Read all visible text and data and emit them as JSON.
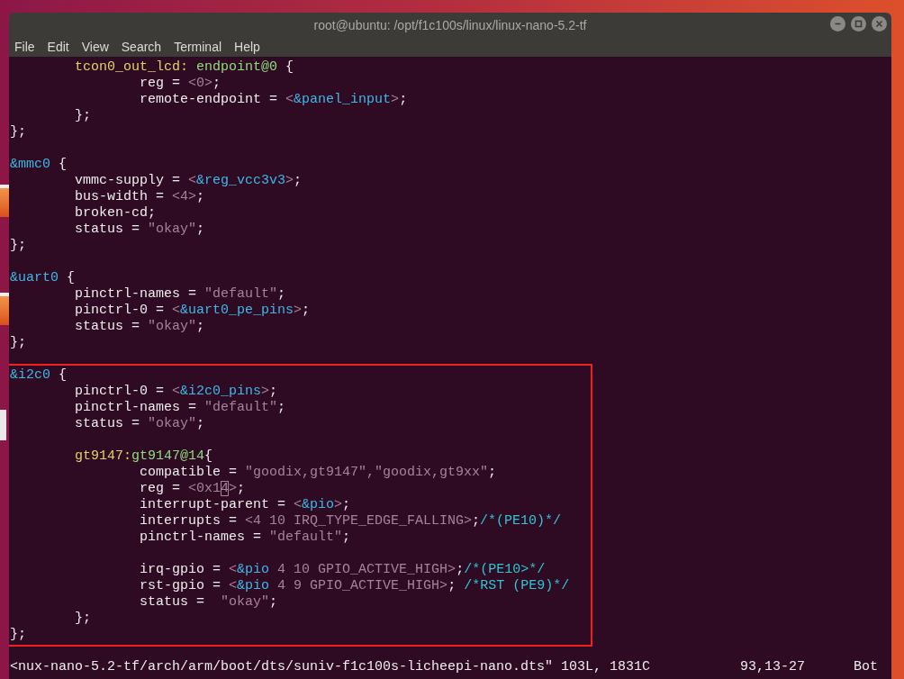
{
  "window": {
    "title": "root@ubuntu: /opt/f1c100s/linux/linux-nano-5.2-tf"
  },
  "menu": [
    "File",
    "Edit",
    "View",
    "Search",
    "Terminal",
    "Help"
  ],
  "lines": [
    {
      "kind": "code",
      "segments": [
        {
          "text": "        tcon0_out_lcd:",
          "kind": "label"
        },
        {
          "text": " endpoint@0",
          "kind": "node"
        },
        {
          "text": " {"
        }
      ]
    },
    {
      "kind": "code",
      "segments": [
        {
          "text": "                reg = "
        },
        {
          "text": "<0>",
          "kind": "value"
        },
        {
          "text": ";"
        }
      ]
    },
    {
      "kind": "code",
      "segments": [
        {
          "text": "                remote-endpoint = "
        },
        {
          "text": "<",
          "kind": "value"
        },
        {
          "text": "&panel_input",
          "kind": "ref"
        },
        {
          "text": ">",
          "kind": "value"
        },
        {
          "text": ";"
        }
      ]
    },
    {
      "kind": "code",
      "segments": [
        {
          "text": "        };"
        }
      ]
    },
    {
      "kind": "code",
      "segments": [
        {
          "text": "};"
        }
      ]
    },
    {
      "kind": "blank"
    },
    {
      "kind": "code",
      "segments": [
        {
          "text": "&mmc0",
          "kind": "ref"
        },
        {
          "text": " {"
        }
      ]
    },
    {
      "kind": "code",
      "segments": [
        {
          "text": "        vmmc-supply = "
        },
        {
          "text": "<",
          "kind": "value"
        },
        {
          "text": "&reg_vcc3v3",
          "kind": "ref"
        },
        {
          "text": ">",
          "kind": "value"
        },
        {
          "text": ";"
        }
      ]
    },
    {
      "kind": "code",
      "segments": [
        {
          "text": "        bus-width = "
        },
        {
          "text": "<4>",
          "kind": "value"
        },
        {
          "text": ";"
        }
      ]
    },
    {
      "kind": "code",
      "segments": [
        {
          "text": "        broken-cd;"
        }
      ]
    },
    {
      "kind": "code",
      "segments": [
        {
          "text": "        status = "
        },
        {
          "text": "\"okay\"",
          "kind": "value"
        },
        {
          "text": ";"
        }
      ]
    },
    {
      "kind": "code",
      "segments": [
        {
          "text": "};"
        }
      ]
    },
    {
      "kind": "blank"
    },
    {
      "kind": "code",
      "segments": [
        {
          "text": "&uart0",
          "kind": "ref"
        },
        {
          "text": " {"
        }
      ]
    },
    {
      "kind": "code",
      "segments": [
        {
          "text": "        pinctrl-names = "
        },
        {
          "text": "\"default\"",
          "kind": "value"
        },
        {
          "text": ";"
        }
      ]
    },
    {
      "kind": "code",
      "segments": [
        {
          "text": "        pinctrl-0 = "
        },
        {
          "text": "<",
          "kind": "value"
        },
        {
          "text": "&uart0_pe_pins",
          "kind": "ref"
        },
        {
          "text": ">",
          "kind": "value"
        },
        {
          "text": ";"
        }
      ]
    },
    {
      "kind": "code",
      "segments": [
        {
          "text": "        status = "
        },
        {
          "text": "\"okay\"",
          "kind": "value"
        },
        {
          "text": ";"
        }
      ]
    },
    {
      "kind": "code",
      "segments": [
        {
          "text": "};"
        }
      ]
    },
    {
      "kind": "blank"
    }
  ],
  "highlight_box": {
    "lines": [
      {
        "kind": "code",
        "segments": [
          {
            "text": "&i2c0",
            "kind": "ref"
          },
          {
            "text": " {"
          }
        ]
      },
      {
        "kind": "code",
        "segments": [
          {
            "text": "        pinctrl-0 = "
          },
          {
            "text": "<",
            "kind": "value"
          },
          {
            "text": "&i2c0_pins",
            "kind": "ref"
          },
          {
            "text": ">",
            "kind": "value"
          },
          {
            "text": ";"
          }
        ]
      },
      {
        "kind": "code",
        "segments": [
          {
            "text": "        pinctrl-names = "
          },
          {
            "text": "\"default\"",
            "kind": "value"
          },
          {
            "text": ";"
          }
        ]
      },
      {
        "kind": "code",
        "segments": [
          {
            "text": "        status = "
          },
          {
            "text": "\"okay\"",
            "kind": "value"
          },
          {
            "text": ";"
          }
        ]
      },
      {
        "kind": "blank"
      },
      {
        "kind": "code",
        "segments": [
          {
            "text": "        gt9147",
            "kind": "label"
          },
          {
            "text": ":",
            "kind": "label"
          },
          {
            "text": "gt9147@14",
            "kind": "node"
          },
          {
            "text": "{"
          }
        ]
      },
      {
        "kind": "code",
        "segments": [
          {
            "text": "                compatible = "
          },
          {
            "text": "\"goodix,gt9147\",\"goodix,gt9xx\"",
            "kind": "value"
          },
          {
            "text": ";"
          }
        ]
      },
      {
        "kind": "code",
        "segments": [
          {
            "text": "                reg = "
          },
          {
            "text": "<0x1",
            "kind": "value"
          },
          {
            "text": "4",
            "kind": "value",
            "cursor": true
          },
          {
            "text": ">",
            "kind": "value"
          },
          {
            "text": ";"
          }
        ]
      },
      {
        "kind": "code",
        "segments": [
          {
            "text": "                interrupt-parent = "
          },
          {
            "text": "<",
            "kind": "value"
          },
          {
            "text": "&pio",
            "kind": "ref"
          },
          {
            "text": ">",
            "kind": "value"
          },
          {
            "text": ";"
          }
        ]
      },
      {
        "kind": "code",
        "segments": [
          {
            "text": "                interrupts = "
          },
          {
            "text": "<4 10 IRQ_TYPE_EDGE_FALLING>",
            "kind": "value"
          },
          {
            "text": ";"
          },
          {
            "text": "/*(PE10)*/",
            "kind": "comment"
          }
        ]
      },
      {
        "kind": "code",
        "segments": [
          {
            "text": "                pinctrl-names = "
          },
          {
            "text": "\"default\"",
            "kind": "value"
          },
          {
            "text": ";"
          }
        ]
      },
      {
        "kind": "blank"
      },
      {
        "kind": "code",
        "segments": [
          {
            "text": "                irq-gpio = "
          },
          {
            "text": "<",
            "kind": "value"
          },
          {
            "text": "&pio",
            "kind": "ref"
          },
          {
            "text": " 4 10 GPIO_ACTIVE_HIGH>",
            "kind": "value"
          },
          {
            "text": ";"
          },
          {
            "text": "/*(PE10>*/",
            "kind": "comment"
          }
        ]
      },
      {
        "kind": "code",
        "segments": [
          {
            "text": "                rst-gpio = "
          },
          {
            "text": "<",
            "kind": "value"
          },
          {
            "text": "&pio",
            "kind": "ref"
          },
          {
            "text": " 4 9 GPIO_ACTIVE_HIGH>",
            "kind": "value"
          },
          {
            "text": "; "
          },
          {
            "text": "/*RST (PE9)*/",
            "kind": "comment"
          }
        ]
      },
      {
        "kind": "code",
        "segments": [
          {
            "text": "                status =  "
          },
          {
            "text": "\"okay\"",
            "kind": "value"
          },
          {
            "text": ";"
          }
        ]
      },
      {
        "kind": "code",
        "segments": [
          {
            "text": "        };"
          }
        ]
      },
      {
        "kind": "code",
        "segments": [
          {
            "text": "};"
          }
        ]
      }
    ]
  },
  "status_line": {
    "file": "<nux-nano-5.2-tf/arch/arm/boot/dts/suniv-f1c100s-licheepi-nano.dts\" 103L, 1831C",
    "position": "93,13-27",
    "scroll": "Bot"
  }
}
